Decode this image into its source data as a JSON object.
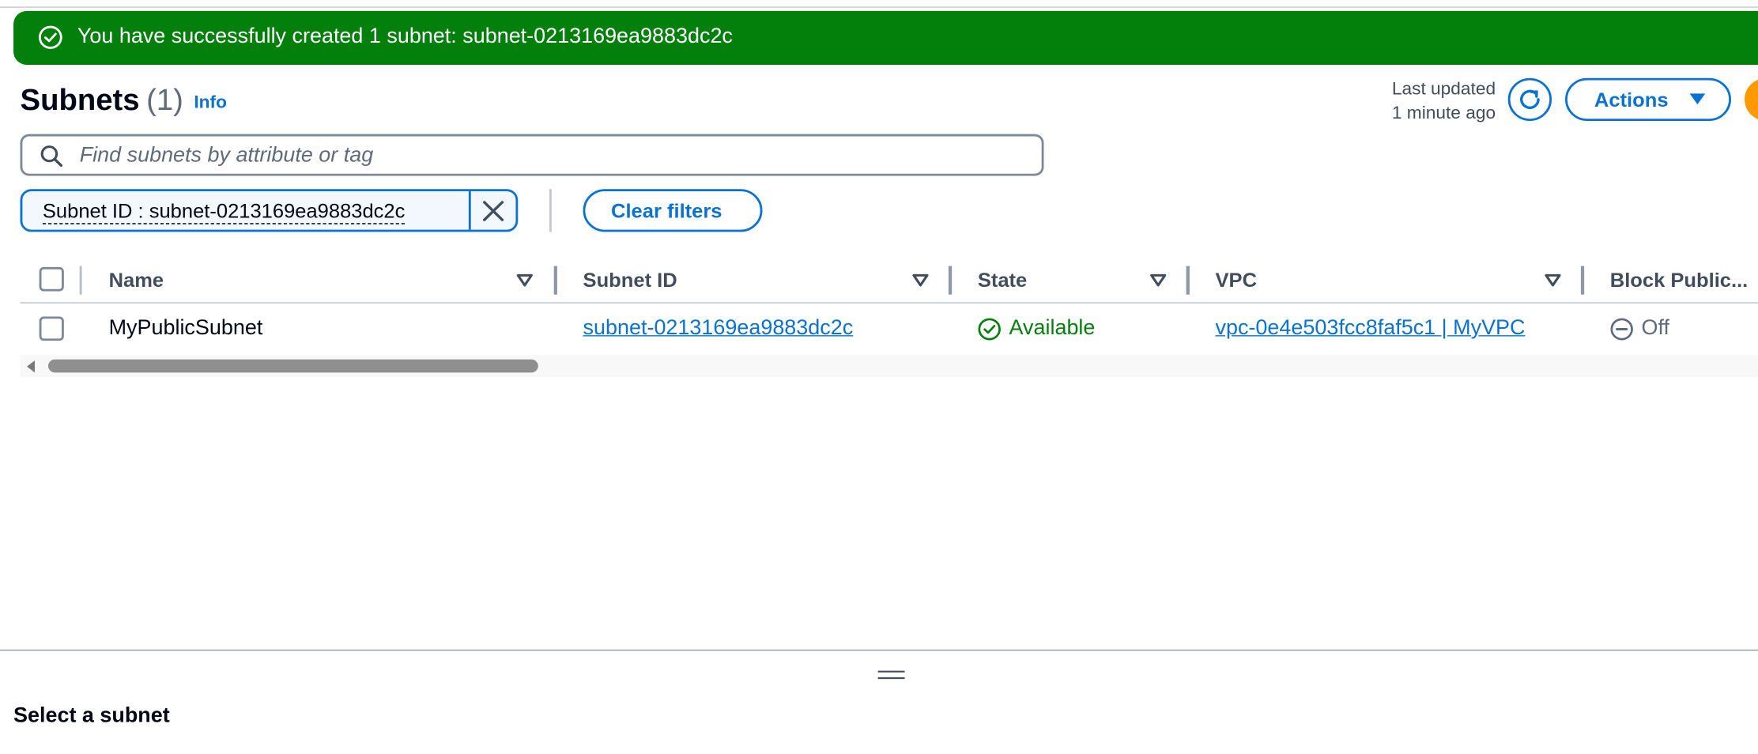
{
  "flash": {
    "message": "You have successfully created 1 subnet: subnet-0213169ea9883dc2c",
    "icon": "check-circle-icon",
    "color": "#037f0c"
  },
  "header": {
    "title": "Subnets",
    "count": "(1)",
    "info_label": "Info",
    "last_updated_label": "Last updated",
    "last_updated_value": "1 minute ago",
    "actions_label": "Actions"
  },
  "search": {
    "placeholder": "Find subnets by attribute or tag",
    "value": ""
  },
  "filter_token": {
    "label": "Subnet ID : subnet-0213169ea9883dc2c"
  },
  "clear_filters_label": "Clear filters",
  "table": {
    "columns": [
      "Name",
      "Subnet ID",
      "State",
      "VPC",
      "Block Public..."
    ],
    "rows": [
      {
        "name": "MyPublicSubnet",
        "subnet_id": "subnet-0213169ea9883dc2c",
        "state": "Available",
        "vpc": "vpc-0e4e503fcc8faf5c1 | MyVPC",
        "block_public": "Off"
      }
    ]
  },
  "split_panel": {
    "title": "Select a subnet"
  },
  "colors": {
    "accent": "#0972d3",
    "success": "#037f0c",
    "primary_button": "#ff9900"
  }
}
